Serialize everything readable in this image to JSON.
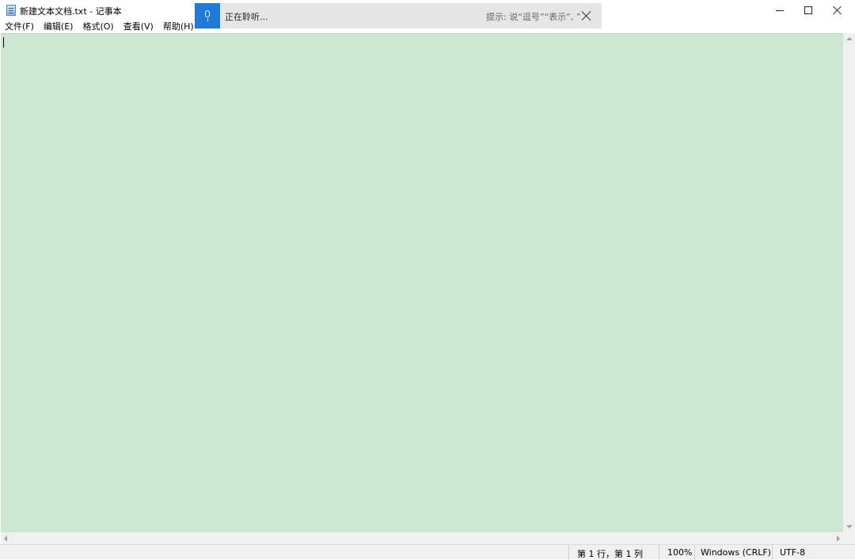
{
  "window": {
    "title": "新建文本文档.txt - 记事本"
  },
  "dictation": {
    "status": "正在聆听...",
    "hint": "提示: 说“逗号”“表示”, ”"
  },
  "menu": {
    "items": [
      {
        "label": "文件(F)"
      },
      {
        "label": "编辑(E)"
      },
      {
        "label": "格式(O)"
      },
      {
        "label": "查看(V)"
      },
      {
        "label": "帮助(H)"
      }
    ]
  },
  "editor": {
    "content": "",
    "background": "#cde8d0"
  },
  "statusbar": {
    "position": "第 1 行，第 1 列",
    "zoom": "100%",
    "line_ending": "Windows (CRLF)",
    "encoding": "UTF-8"
  },
  "colors": {
    "accent": "#1e7ad6"
  },
  "icons": {
    "app": "notepad-icon",
    "mic": "microphone-icon",
    "minimize": "minimize-icon",
    "maximize": "maximize-icon",
    "close": "close-icon"
  }
}
